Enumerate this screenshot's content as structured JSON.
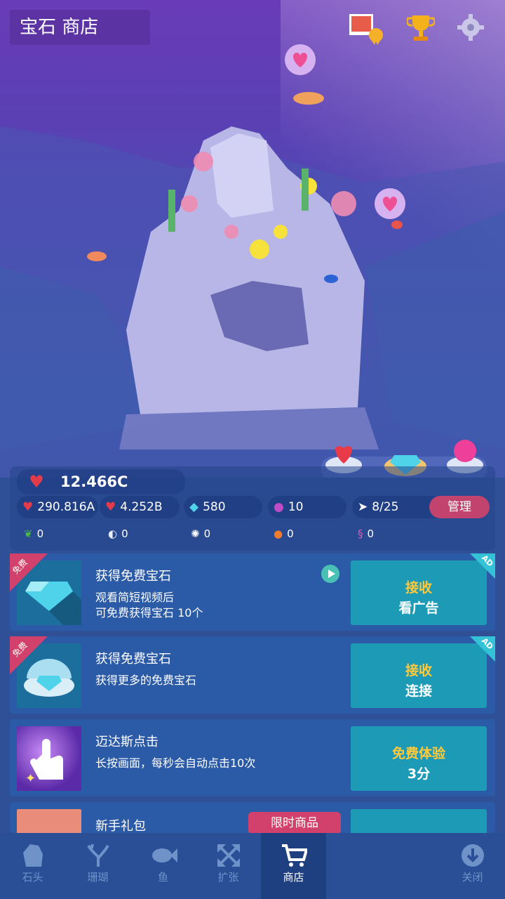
{
  "header": {
    "title": "宝石 商店"
  },
  "stats": {
    "hearts_total": "12.466C",
    "hearts_per_tap": "290.816A",
    "hearts_per_sec": "4.252B",
    "gems": "580",
    "pearls": "10",
    "fish": "8/25",
    "manage_label": "管理",
    "seaweed": "0",
    "shell": "0",
    "urchin": "0",
    "crab": "0",
    "seahorse": "0"
  },
  "cards": [
    {
      "badge": "免费",
      "title": "获得免费宝石",
      "desc": "观看简短视频后\n可免费获得宝石 10个",
      "btn_top": "接收",
      "btn_bottom": "看广告",
      "ad": "AD"
    },
    {
      "badge": "免费",
      "title": "获得免费宝石",
      "desc": "获得更多的免费宝石",
      "btn_top": "接收",
      "btn_bottom": "连接",
      "ad": "AD"
    },
    {
      "title": "迈达斯点击",
      "desc": "长按画面，每秒会自动点击10次",
      "btn_top": "免费体验",
      "btn_bottom": "3分"
    },
    {
      "title": "新手礼包",
      "tag": "限时商品"
    }
  ],
  "nav": {
    "items": [
      {
        "label": "石头",
        "icon": "rock-icon"
      },
      {
        "label": "珊瑚",
        "icon": "coral-icon"
      },
      {
        "label": "鱼",
        "icon": "fish-icon"
      },
      {
        "label": "扩张",
        "icon": "expand-icon"
      },
      {
        "label": "商店",
        "icon": "cart-icon"
      },
      {
        "label": "关闭",
        "icon": "close-down-icon"
      }
    ]
  }
}
